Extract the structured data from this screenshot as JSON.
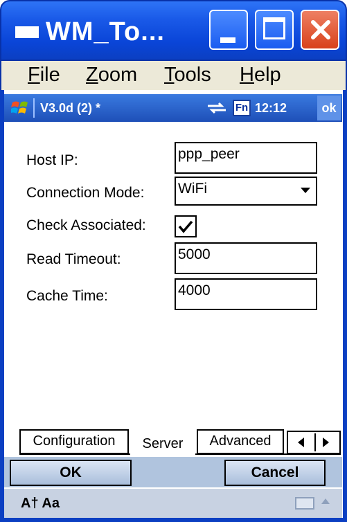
{
  "window": {
    "title": "WM_To..."
  },
  "menu": {
    "file": "File",
    "zoom": "Zoom",
    "tools": "Tools",
    "help": "Help"
  },
  "status": {
    "title": "V3.0d (2)  *",
    "fn": "Fn",
    "time": "12:12",
    "ok": "ok"
  },
  "form": {
    "host_ip": {
      "label": "Host IP:",
      "value": "ppp_peer"
    },
    "connection_mode": {
      "label": "Connection Mode:",
      "value": "WiFi"
    },
    "check_associated": {
      "label": "Check Associated:",
      "checked": true
    },
    "read_timeout": {
      "label": "Read Timeout:",
      "value": "5000"
    },
    "cache_time": {
      "label": "Cache Time:",
      "value": "4000"
    }
  },
  "tabs": [
    {
      "label": "Configuration",
      "active": false
    },
    {
      "label": "Server",
      "active": true
    },
    {
      "label": "Advanced",
      "active": false
    }
  ],
  "softkeys": {
    "ok": "OK",
    "cancel": "Cancel"
  },
  "input": {
    "label": "A† Aa"
  },
  "colors": {
    "titlebar": "#0a45d8",
    "close": "#d8411b",
    "softbar": "#b0c4de"
  }
}
